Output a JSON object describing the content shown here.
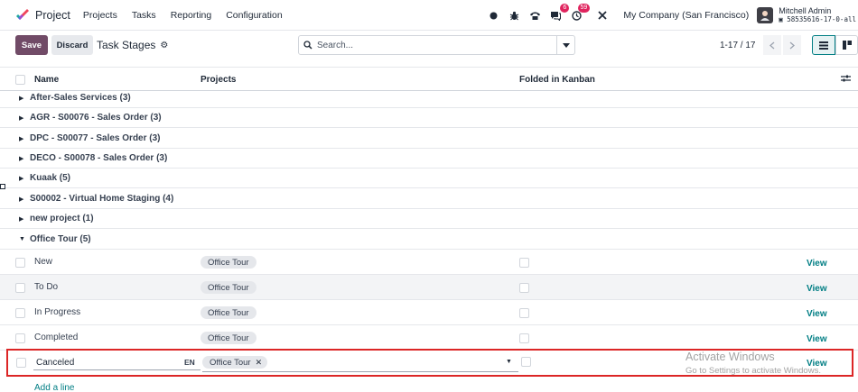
{
  "navbar": {
    "app_name": "Project",
    "menu": [
      "Projects",
      "Tasks",
      "Reporting",
      "Configuration"
    ],
    "badges": {
      "messages": "6",
      "activities": "59"
    },
    "company": "My Company (San Francisco)",
    "user_name": "Mitchell Admin",
    "database": "58535616-17-0-all"
  },
  "control": {
    "save_label": "Save",
    "discard_label": "Discard",
    "breadcrumb": "Task Stages",
    "search_placeholder": "Search...",
    "pager": "1-17 / 17"
  },
  "table": {
    "columns": {
      "name": "Name",
      "projects": "Projects",
      "folded": "Folded in Kanban"
    },
    "groups": [
      "After-Sales Services (3)",
      "AGR - S00076 - Sales Order (3)",
      "DPC - S00077 - Sales Order (3)",
      "DECO - S00078 - Sales Order (3)",
      "Kuaak (5)",
      "S00002 - Virtual Home Staging (4)",
      "new project (1)",
      "Office Tour (5)"
    ],
    "rows": [
      {
        "name": "New",
        "project": "Office Tour",
        "action": "View"
      },
      {
        "name": "To Do",
        "project": "Office Tour",
        "action": "View"
      },
      {
        "name": "In Progress",
        "project": "Office Tour",
        "action": "View"
      },
      {
        "name": "Completed",
        "project": "Office Tour",
        "action": "View"
      }
    ],
    "editing_row": {
      "name_value": "Canceled",
      "lang": "EN",
      "project": "Office Tour",
      "action": "View"
    },
    "add_line": "Add a line"
  },
  "watermark": {
    "line1": "Activate Windows",
    "line2": "Go to Settings to activate Windows."
  }
}
